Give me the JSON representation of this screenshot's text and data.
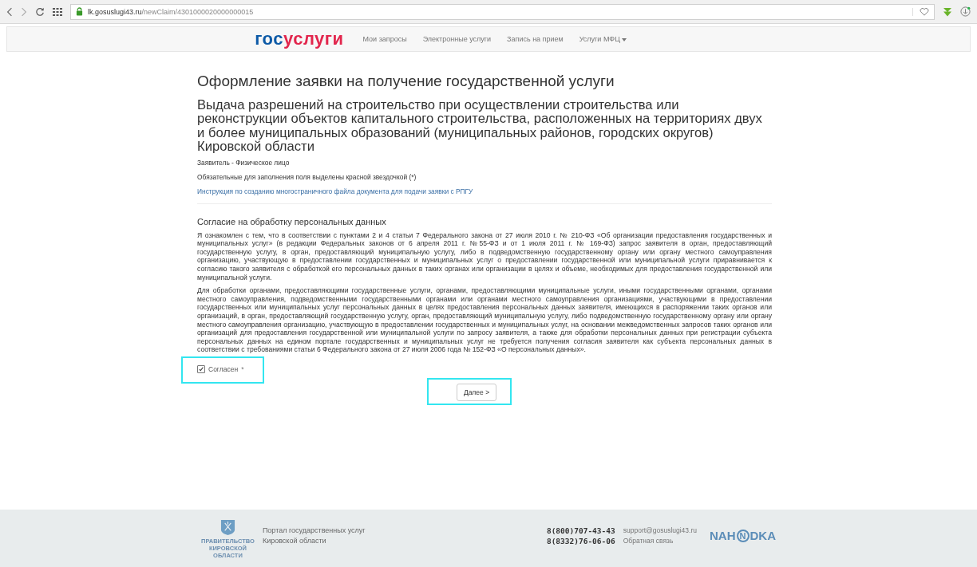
{
  "browser": {
    "url_host": "lk.gosuslugi43.ru",
    "url_path": "/newClaim/4301000020000000015"
  },
  "nav": {
    "logo": [
      "гос",
      "услуги"
    ],
    "links": [
      {
        "label": "Мои запросы",
        "dropdown": false
      },
      {
        "label": "Электронные услуги",
        "dropdown": false
      },
      {
        "label": "Запись на прием",
        "dropdown": false
      },
      {
        "label": "Услуги МФЦ",
        "dropdown": true
      }
    ]
  },
  "page": {
    "title": "Оформление заявки на получение государственной услуги",
    "service": "Выдача разрешений на строительство при осуществлении строительства или реконструкции объектов капитального строительства, расположенных на территориях двух и более муниципальных образований (муниципальных районов, городских округов) Кировской области",
    "applicant": "Заявитель - Физическое лицо",
    "required_note": "Обязательные для заполнения поля выделены красной звездочкой (*)",
    "instruction_link": "Инструкция по созданию многостраничного файла документа для подачи заявки с РПГУ"
  },
  "consent": {
    "heading": "Согласие на обработку персональных данных",
    "paragraphs": [
      "Я ознакомлен с тем, что в соответствии с пунктами 2 и 4 статьи 7 Федерального закона от 27 июля 2010 г. № 210-ФЗ «Об организации предоставления государственных и муниципальных услуг» (в редакции Федеральных законов от 6 апреля 2011 г. №55-ФЗ и от 1 июля 2011 г. № 169-ФЗ) запрос заявителя в орган, предоставляющий государственную услугу, в орган, предоставляющий муниципальную услугу, либо в подведомственную государственному органу или органу местного самоуправления организацию, участвующую в предоставлении государственных и муниципальных услуг о предоставлении государственной или муниципальной услуги приравнивается к согласию такого заявителя с обработкой его персональных данных в таких органах или организации в целях и объеме, необходимых для предоставления государственной или муниципальной услуги.",
      "Для обработки органами, предоставляющими государственные услуги, органами, предоставляющими муниципальные услуги, иными государственными органами, органами местного самоуправления, подведомственными государственными органами или органами местного самоуправления организациями, участвующими в предоставлении государственных или муниципальных услуг персональных данных в целях предоставления персональных данных заявителя, имеющихся в распоряжении таких органов или организаций, в орган, предоставляющий государственную услугу, орган, предоставляющий муниципальную услугу, либо подведомственную государственному органу или органу местного самоуправления организацию, участвующую в предоставлении государственных и муниципальных услуг, на основании межведомственных запросов таких органов или организаций для предоставления государственной или муниципальной услуги по запросу заявителя, а также для обработки персональных данных при регистрации субъекта персональных данных на едином портале государственных и муниципальных услуг не требуется получения согласия заявителя как субъекта персональных данных в соответствии с требованиями статьи 6 Федерального закона от 27 июля 2006 года № 152-ФЗ «О персональных данных»."
    ],
    "checkbox": {
      "label": "Согласен",
      "required_mark": "*",
      "checked": true
    },
    "next_button": "Далее >"
  },
  "footer": {
    "emblem_caption": [
      "ПРАВИТЕЛЬСТВО",
      "КИРОВСКОЙ",
      "ОБЛАСТИ"
    ],
    "portal_name": [
      "Портал государственных услуг",
      "Кировской области"
    ],
    "phones": [
      "8(800)707-43-43",
      "8(8332)76-06-06"
    ],
    "email": "support@gosuslugi43.ru",
    "feedback_link": "Обратная связь",
    "partner_logo": [
      "NAH",
      "N",
      "DKA"
    ]
  }
}
